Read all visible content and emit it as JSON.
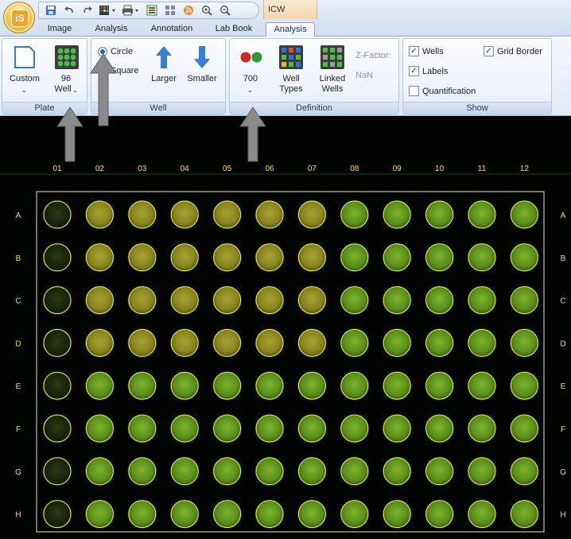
{
  "app": {
    "logo_text": "iS",
    "context_tab": "ICW"
  },
  "quick_access": {
    "icons": [
      "save-icon",
      "undo-icon",
      "redo-icon",
      "grid-color-icon",
      "print-icon",
      "export-icon",
      "layout-icon",
      "rss-icon",
      "zoom-in-icon",
      "zoom-out-icon"
    ]
  },
  "tabs": [
    {
      "label": "Image",
      "active": false
    },
    {
      "label": "Analysis",
      "active": false
    },
    {
      "label": "Annotation",
      "active": false
    },
    {
      "label": "Lab Book",
      "active": false
    },
    {
      "label": "Analysis",
      "active": true
    }
  ],
  "ribbon": {
    "plate": {
      "label": "Plate",
      "custom": {
        "label": "Custom"
      },
      "well96": {
        "label_top": "96",
        "label_bottom": "Well"
      }
    },
    "well": {
      "label": "Well",
      "circle": {
        "label": "Circle",
        "selected": true
      },
      "square": {
        "label": "Square",
        "selected": false
      },
      "larger": {
        "label": "Larger"
      },
      "smaller": {
        "label": "Smaller"
      }
    },
    "definition": {
      "label": "Definition",
      "channel": {
        "label": "700"
      },
      "well_types": {
        "label_top": "Well",
        "label_bottom": "Types"
      },
      "linked_wells": {
        "label_top": "Linked",
        "label_bottom": "Wells"
      },
      "zfactor_label": "Z-Factor:",
      "zfactor_value": "NaN"
    },
    "show": {
      "label": "Show",
      "launcher": "›",
      "wells": {
        "label": "Wells",
        "checked": true
      },
      "labels": {
        "label": "Labels",
        "checked": true
      },
      "quantification": {
        "label": "Quantification",
        "checked": false
      },
      "grid_border": {
        "label": "Grid Border",
        "checked": true
      }
    }
  },
  "plate": {
    "columns": [
      "01",
      "02",
      "03",
      "04",
      "05",
      "06",
      "07",
      "08",
      "09",
      "10",
      "11",
      "12"
    ],
    "rows": [
      "A",
      "B",
      "C",
      "D",
      "E",
      "F",
      "G",
      "H"
    ],
    "label_color": "#f2e23a",
    "grid_color": "#ecec9a",
    "well_outline_color": "#f3f35a",
    "background_color": "#020402"
  },
  "colors": {
    "ribbon_bg": "#e1e9f5",
    "accent_blue": "#2a7ae2",
    "arrow_gray": "#8a8a8a"
  }
}
